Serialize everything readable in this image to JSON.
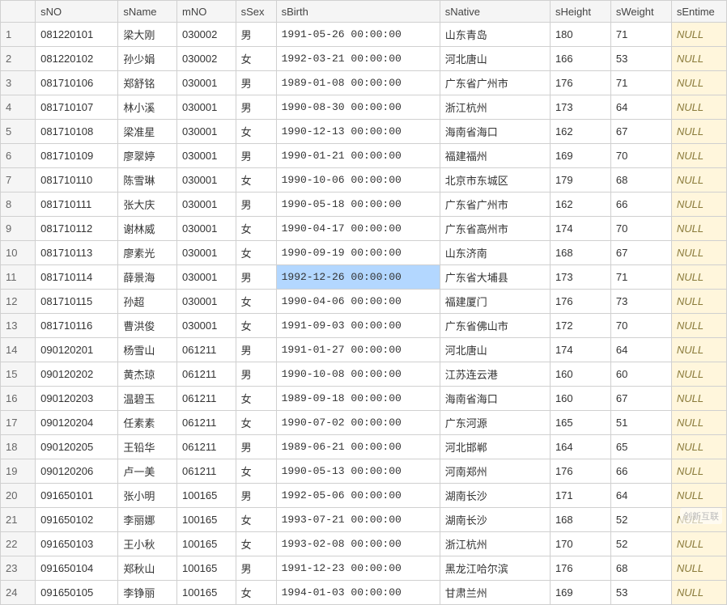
{
  "columns": [
    "sNO",
    "sName",
    "mNO",
    "sSex",
    "sBirth",
    "sNative",
    "sHeight",
    "sWeight",
    "sEntime"
  ],
  "null_text": "NULL",
  "selected": {
    "row": 11,
    "col": "sBirth"
  },
  "rows": [
    {
      "n": 1,
      "sNO": "081220101",
      "sName": "梁大刚",
      "mNO": "030002",
      "sSex": "男",
      "sBirth": "1991-05-26 00:00:00",
      "sNative": "山东青岛",
      "sHeight": 180,
      "sWeight": 71,
      "sEntime": null
    },
    {
      "n": 2,
      "sNO": "081220102",
      "sName": "孙少娟",
      "mNO": "030002",
      "sSex": "女",
      "sBirth": "1992-03-21 00:00:00",
      "sNative": "河北唐山",
      "sHeight": 166,
      "sWeight": 53,
      "sEntime": null
    },
    {
      "n": 3,
      "sNO": "081710106",
      "sName": "郑舒铭",
      "mNO": "030001",
      "sSex": "男",
      "sBirth": "1989-01-08 00:00:00",
      "sNative": "广东省广州市",
      "sHeight": 176,
      "sWeight": 71,
      "sEntime": null
    },
    {
      "n": 4,
      "sNO": "081710107",
      "sName": "林小溪",
      "mNO": "030001",
      "sSex": "男",
      "sBirth": "1990-08-30 00:00:00",
      "sNative": "浙江杭州",
      "sHeight": 173,
      "sWeight": 64,
      "sEntime": null
    },
    {
      "n": 5,
      "sNO": "081710108",
      "sName": "梁准星",
      "mNO": "030001",
      "sSex": "女",
      "sBirth": "1990-12-13 00:00:00",
      "sNative": "海南省海口",
      "sHeight": 162,
      "sWeight": 67,
      "sEntime": null
    },
    {
      "n": 6,
      "sNO": "081710109",
      "sName": "廖翠婷",
      "mNO": "030001",
      "sSex": "男",
      "sBirth": "1990-01-21 00:00:00",
      "sNative": "福建福州",
      "sHeight": 169,
      "sWeight": 70,
      "sEntime": null
    },
    {
      "n": 7,
      "sNO": "081710110",
      "sName": "陈雪琳",
      "mNO": "030001",
      "sSex": "女",
      "sBirth": "1990-10-06 00:00:00",
      "sNative": "北京市东城区",
      "sHeight": 179,
      "sWeight": 68,
      "sEntime": null
    },
    {
      "n": 8,
      "sNO": "081710111",
      "sName": "张大庆",
      "mNO": "030001",
      "sSex": "男",
      "sBirth": "1990-05-18 00:00:00",
      "sNative": "广东省广州市",
      "sHeight": 162,
      "sWeight": 66,
      "sEntime": null
    },
    {
      "n": 9,
      "sNO": "081710112",
      "sName": "谢林威",
      "mNO": "030001",
      "sSex": "女",
      "sBirth": "1990-04-17 00:00:00",
      "sNative": "广东省高州市",
      "sHeight": 174,
      "sWeight": 70,
      "sEntime": null
    },
    {
      "n": 10,
      "sNO": "081710113",
      "sName": "廖素光",
      "mNO": "030001",
      "sSex": "女",
      "sBirth": "1990-09-19 00:00:00",
      "sNative": "山东济南",
      "sHeight": 168,
      "sWeight": 67,
      "sEntime": null
    },
    {
      "n": 11,
      "sNO": "081710114",
      "sName": "薛景海",
      "mNO": "030001",
      "sSex": "男",
      "sBirth": "1992-12-26 00:00:00",
      "sNative": "广东省大埔县",
      "sHeight": 173,
      "sWeight": 71,
      "sEntime": null
    },
    {
      "n": 12,
      "sNO": "081710115",
      "sName": "孙超",
      "mNO": "030001",
      "sSex": "女",
      "sBirth": "1990-04-06 00:00:00",
      "sNative": "福建厦门",
      "sHeight": 176,
      "sWeight": 73,
      "sEntime": null
    },
    {
      "n": 13,
      "sNO": "081710116",
      "sName": "曹洪俊",
      "mNO": "030001",
      "sSex": "女",
      "sBirth": "1991-09-03 00:00:00",
      "sNative": "广东省佛山市",
      "sHeight": 172,
      "sWeight": 70,
      "sEntime": null
    },
    {
      "n": 14,
      "sNO": "090120201",
      "sName": "杨雪山",
      "mNO": "061211",
      "sSex": "男",
      "sBirth": "1991-01-27 00:00:00",
      "sNative": "河北唐山",
      "sHeight": 174,
      "sWeight": 64,
      "sEntime": null
    },
    {
      "n": 15,
      "sNO": "090120202",
      "sName": "黄杰琼",
      "mNO": "061211",
      "sSex": "男",
      "sBirth": "1990-10-08 00:00:00",
      "sNative": "江苏连云港",
      "sHeight": 160,
      "sWeight": 60,
      "sEntime": null
    },
    {
      "n": 16,
      "sNO": "090120203",
      "sName": "温碧玉",
      "mNO": "061211",
      "sSex": "女",
      "sBirth": "1989-09-18 00:00:00",
      "sNative": "海南省海口",
      "sHeight": 160,
      "sWeight": 67,
      "sEntime": null
    },
    {
      "n": 17,
      "sNO": "090120204",
      "sName": "任素素",
      "mNO": "061211",
      "sSex": "女",
      "sBirth": "1990-07-02 00:00:00",
      "sNative": "广东河源",
      "sHeight": 165,
      "sWeight": 51,
      "sEntime": null
    },
    {
      "n": 18,
      "sNO": "090120205",
      "sName": "王铅华",
      "mNO": "061211",
      "sSex": "男",
      "sBirth": "1989-06-21 00:00:00",
      "sNative": "河北邯郸",
      "sHeight": 164,
      "sWeight": 65,
      "sEntime": null
    },
    {
      "n": 19,
      "sNO": "090120206",
      "sName": "卢一美",
      "mNO": "061211",
      "sSex": "女",
      "sBirth": "1990-05-13 00:00:00",
      "sNative": "河南郑州",
      "sHeight": 176,
      "sWeight": 66,
      "sEntime": null
    },
    {
      "n": 20,
      "sNO": "091650101",
      "sName": "张小明",
      "mNO": "100165",
      "sSex": "男",
      "sBirth": "1992-05-06 00:00:00",
      "sNative": "湖南长沙",
      "sHeight": 171,
      "sWeight": 64,
      "sEntime": null
    },
    {
      "n": 21,
      "sNO": "091650102",
      "sName": "李丽娜",
      "mNO": "100165",
      "sSex": "女",
      "sBirth": "1993-07-21 00:00:00",
      "sNative": "湖南长沙",
      "sHeight": 168,
      "sWeight": 52,
      "sEntime": null
    },
    {
      "n": 22,
      "sNO": "091650103",
      "sName": "王小秋",
      "mNO": "100165",
      "sSex": "女",
      "sBirth": "1993-02-08 00:00:00",
      "sNative": "浙江杭州",
      "sHeight": 170,
      "sWeight": 52,
      "sEntime": null
    },
    {
      "n": 23,
      "sNO": "091650104",
      "sName": "郑秋山",
      "mNO": "100165",
      "sSex": "男",
      "sBirth": "1991-12-23 00:00:00",
      "sNative": "黑龙江哈尔滨",
      "sHeight": 176,
      "sWeight": 68,
      "sEntime": null
    },
    {
      "n": 24,
      "sNO": "091650105",
      "sName": "李铮丽",
      "mNO": "100165",
      "sSex": "女",
      "sBirth": "1994-01-03 00:00:00",
      "sNative": "甘肃兰州",
      "sHeight": 169,
      "sWeight": 53,
      "sEntime": null
    }
  ],
  "watermark": "创新互联"
}
